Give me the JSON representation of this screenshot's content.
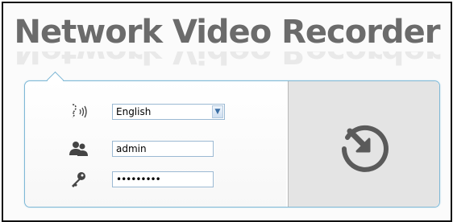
{
  "header": {
    "title": "Network Video Recorder"
  },
  "login": {
    "language": {
      "icon": "language-speaker-icon",
      "selected": "English"
    },
    "username": {
      "icon": "users-icon",
      "value": "admin"
    },
    "password": {
      "icon": "key-icon",
      "value": "•••••••••"
    },
    "submit": {
      "icon": "login-arrow-icon"
    }
  },
  "colors": {
    "title": "#6b6b6b",
    "panel_border": "#7fb8d6",
    "login_bg": "#e4e4e4"
  }
}
